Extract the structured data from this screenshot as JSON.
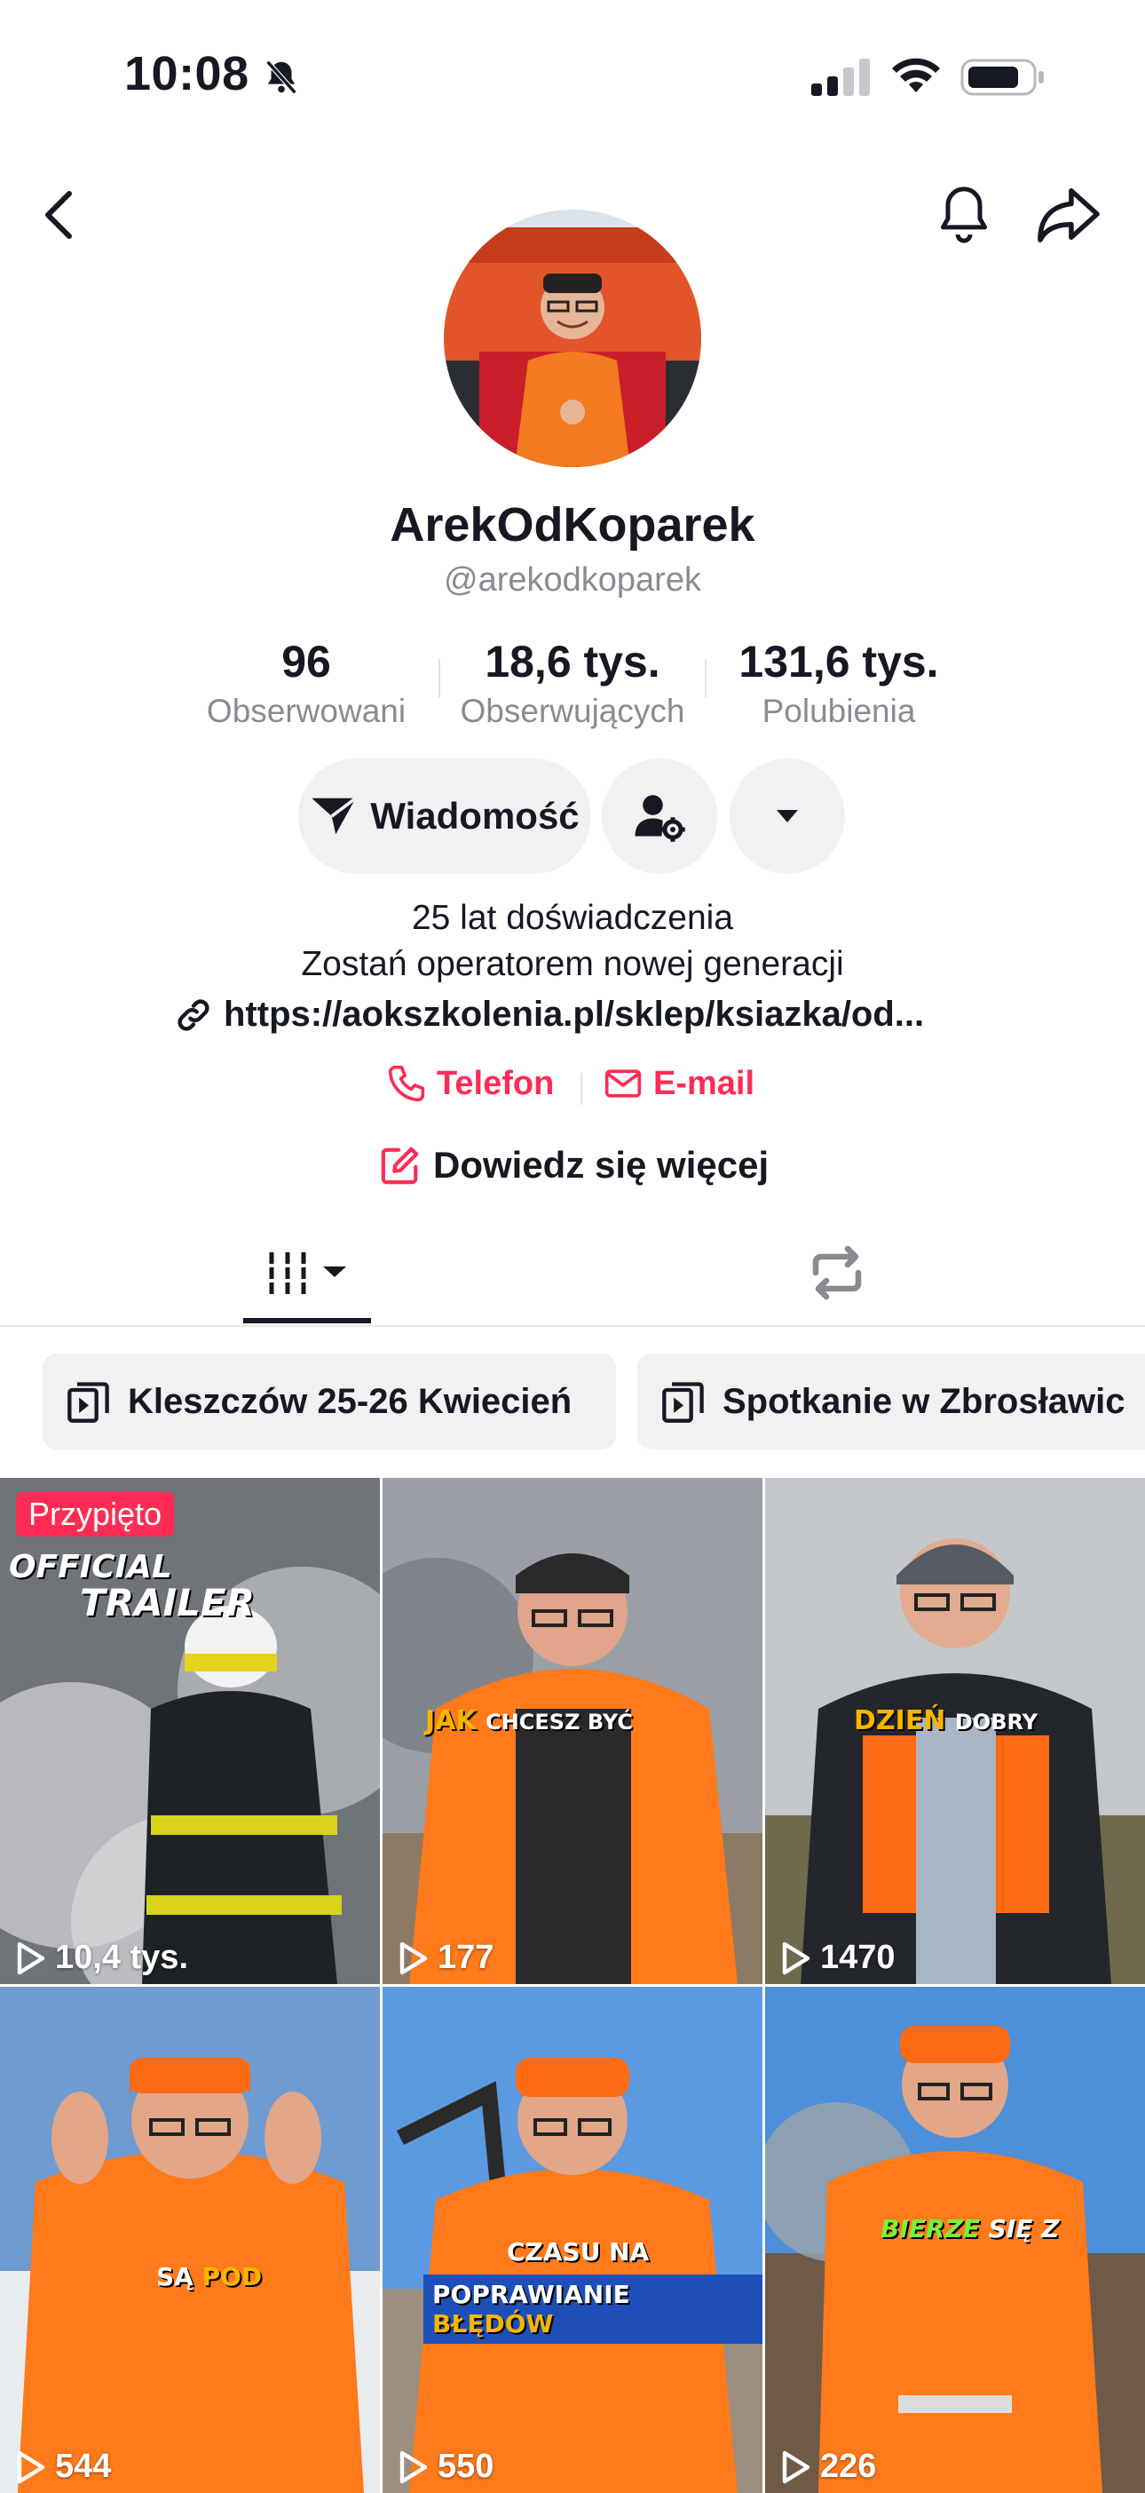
{
  "status_bar": {
    "time": "10:08"
  },
  "profile": {
    "display_name": "ArekOdKoparek",
    "handle": "@arekodkoparek",
    "stats": [
      {
        "value": "96",
        "label": "Obserwowani"
      },
      {
        "value": "18,6 tys.",
        "label": "Obserwujących"
      },
      {
        "value": "131,6 tys.",
        "label": "Polubienia"
      }
    ]
  },
  "actions": {
    "message_label": "Wiadomość"
  },
  "bio": {
    "line1": "25 lat doświadczenia",
    "line2": "Zostań operatorem nowej generacji",
    "link": "https://aokszkolenia.pl/sklep/ksiazka/od..."
  },
  "contacts": {
    "phone": "Telefon",
    "email": "E-mail"
  },
  "learn_more": "Dowiedz się więcej",
  "playlists": [
    {
      "label": "Kleszczów 25-26 Kwiecień"
    },
    {
      "label": "Spotkanie w Zbrosławic"
    }
  ],
  "videos": [
    {
      "pinned": "Przypięto",
      "caption1": "OFFICIAL",
      "caption2": "TRAILER",
      "views": "10,4 tys."
    },
    {
      "caption_hl": "JAK",
      "caption": "CHCESZ BYĆ",
      "views": "177"
    },
    {
      "caption_hl": "DZIEŃ",
      "caption": "DOBRY",
      "views": "1470"
    },
    {
      "caption": "SĄ",
      "caption_hl": "POD",
      "views": "544"
    },
    {
      "caption1": "CZASU NA",
      "caption2": "POPRAWIANIE",
      "caption3": "BŁĘDÓW",
      "views": "550"
    },
    {
      "caption_hl": "BIERZE",
      "caption": "SIĘ Z",
      "views": "226"
    }
  ],
  "colors": {
    "accent": "#fe2c55",
    "text": "#161823",
    "muted": "#8a8b91",
    "surface": "#f1f1f2"
  }
}
